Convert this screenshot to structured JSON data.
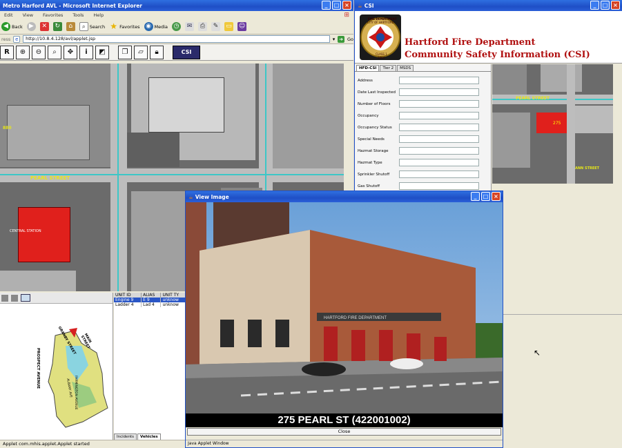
{
  "ie": {
    "title": "Metro Harford AVL - Microsoft Internet Explorer",
    "menu": [
      "Edit",
      "View",
      "Favorites",
      "Tools",
      "Help"
    ],
    "toolbar": {
      "back": "Back",
      "search": "Search",
      "favorites": "Favorites",
      "media": "Media"
    },
    "address_label": "ress",
    "address": "http://10.8.4.128/avl/applet.jsp",
    "go": "Go",
    "csi_button": "CSI",
    "map_labels": {
      "pearl_street": "PEARL STREET",
      "central_station": "CENTRAL STATION",
      "east_label": "880"
    },
    "units_table": {
      "headers": [
        "UNIT ID",
        "ALIAS",
        "UNIT TY"
      ],
      "rows": [
        [
          "Engine 9",
          "E 9",
          "unknow"
        ],
        [
          "Ladder 4",
          "Lad 4",
          "unknow"
        ]
      ]
    },
    "overview_labels": [
      "PROSPECT AVENUE",
      "MAIN STREET",
      "GRANBY STREET",
      "FARMINGTON AVENUE",
      "ALBANY AVE"
    ],
    "bottom_tabs": [
      "Incidents",
      "Vehicles"
    ],
    "status": "Applet com.mhis.applet.Applet started"
  },
  "csi": {
    "title": "CSI",
    "logo_top": "FIRE DEPARTMENT",
    "logo_bottom": "CITY OF HARTFORD",
    "logo_ring_lower": "CLASS 1",
    "logo_est": "1864",
    "header_line1": "Hartford Fire Department",
    "header_line2": "Community Safety Information (CSI)",
    "tabs": [
      "HFD-CSI",
      "Tier 2",
      "MSDS"
    ],
    "fields": [
      "Address",
      "Date Last Inspected",
      "Number of Floors",
      "Occupancy",
      "Occupancy Status",
      "Special Needs",
      "Hazmat Storage",
      "Hazmat Type",
      "Sprinkler Shutoff",
      "Gas Shutoff"
    ],
    "map_labels": {
      "pearl": "PEARL STREET",
      "station_num": "275",
      "ann": "ANN STREET"
    }
  },
  "view_image": {
    "title": "View Image",
    "caption": "275 PEARL ST  (422001002)",
    "close": "Close",
    "status": "Java Applet Window",
    "signage": "HARTFORD FIRE DEPARTMENT"
  },
  "colors": {
    "xp_blue": "#1f4fc6",
    "station_red": "#e0201c",
    "csi_title_red": "#b01010"
  }
}
